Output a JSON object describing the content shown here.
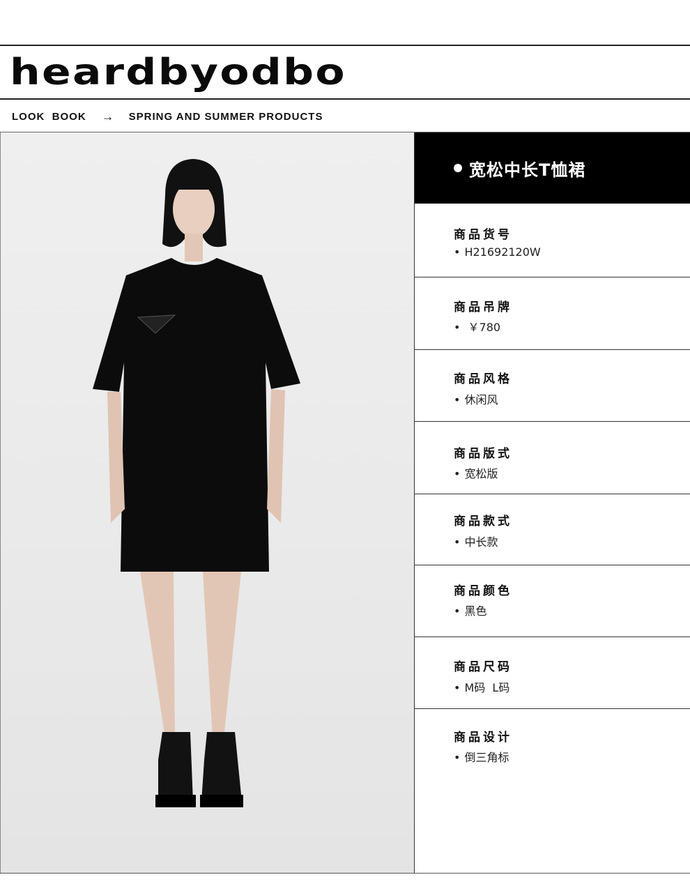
{
  "brand": {
    "name": "heardbyodbo"
  },
  "breadcrumb": {
    "first": "LOOK  BOOK",
    "arrow": "→",
    "second": "SPRING AND SUMMER PRODUCTS"
  },
  "product": {
    "title": "宽松中长T恤裙",
    "attributes": [
      {
        "label": "商品货号",
        "value": "H21692120W"
      },
      {
        "label": "商品吊牌",
        "value": " ￥780"
      },
      {
        "label": "商品风格",
        "value": "休闲风"
      },
      {
        "label": "商品版式",
        "value": "宽松版"
      },
      {
        "label": "商品款式",
        "value": "中长款"
      },
      {
        "label": "商品颜色",
        "value": "黑色"
      },
      {
        "label": "商品尺码",
        "value": "M码  L码"
      },
      {
        "label": "商品设计",
        "value": "倒三角标"
      }
    ]
  },
  "colors": {
    "accent": "#000000",
    "background": "#ffffff"
  }
}
